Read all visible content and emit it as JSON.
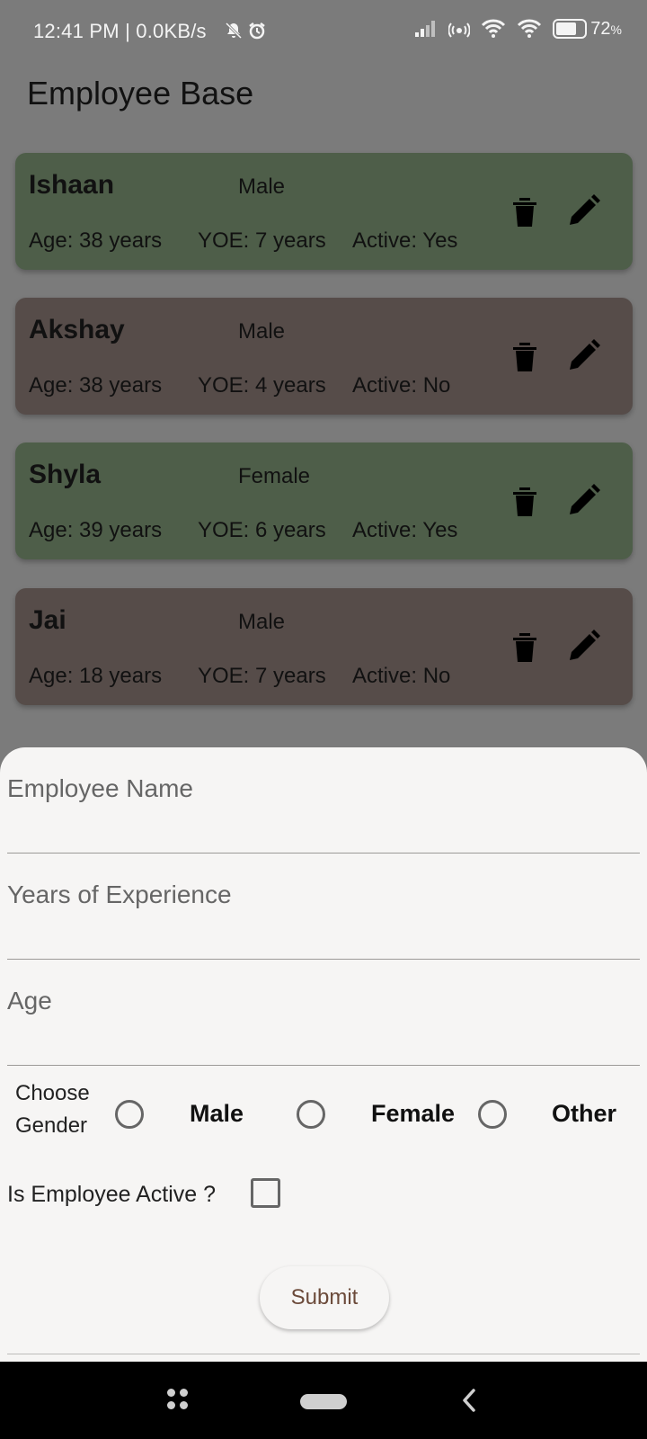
{
  "status_bar": {
    "time": "12:41 PM | 0.0KB/s",
    "battery": "72",
    "battery_unit": "%",
    "icons": [
      "mute-bell-icon",
      "alarm-icon",
      "signal-icon",
      "hotspot-icon",
      "wifi-icon",
      "wifi-icon",
      "battery-icon"
    ]
  },
  "app_bar": {
    "title": "Employee Base"
  },
  "employees": [
    {
      "name": "Ishaan",
      "gender": "Male",
      "age": "Age: 38 years",
      "yoe": "YOE: 7 years",
      "active": "Active: Yes",
      "color": "#4e5e49"
    },
    {
      "name": "Akshay",
      "gender": "Male",
      "age": "Age: 38 years",
      "yoe": "YOE: 4 years",
      "active": "Active: No",
      "color": "#564c49"
    },
    {
      "name": "Shyla",
      "gender": "Female",
      "age": "Age: 39 years",
      "yoe": "YOE: 6 years",
      "active": "Active: Yes",
      "color": "#4e5e49"
    },
    {
      "name": "Jai",
      "gender": "Male",
      "age": "Age: 18 years",
      "yoe": "YOE: 7 years",
      "active": "Active: No",
      "color": "#564c49"
    }
  ],
  "form": {
    "name_label": "Employee Name",
    "yoe_label": "Years of Experience",
    "age_label": "Age",
    "gender_title": "Choose Gender",
    "gender_options": [
      "Male",
      "Female",
      "Other"
    ],
    "active_label": "Is Employee Active ?",
    "submit_label": "Submit"
  },
  "colors": {
    "active_card": "#4e5e49",
    "inactive_card": "#564c49",
    "sheet_bg": "#f6f5f4",
    "submit_text": "#6b4a3a"
  }
}
